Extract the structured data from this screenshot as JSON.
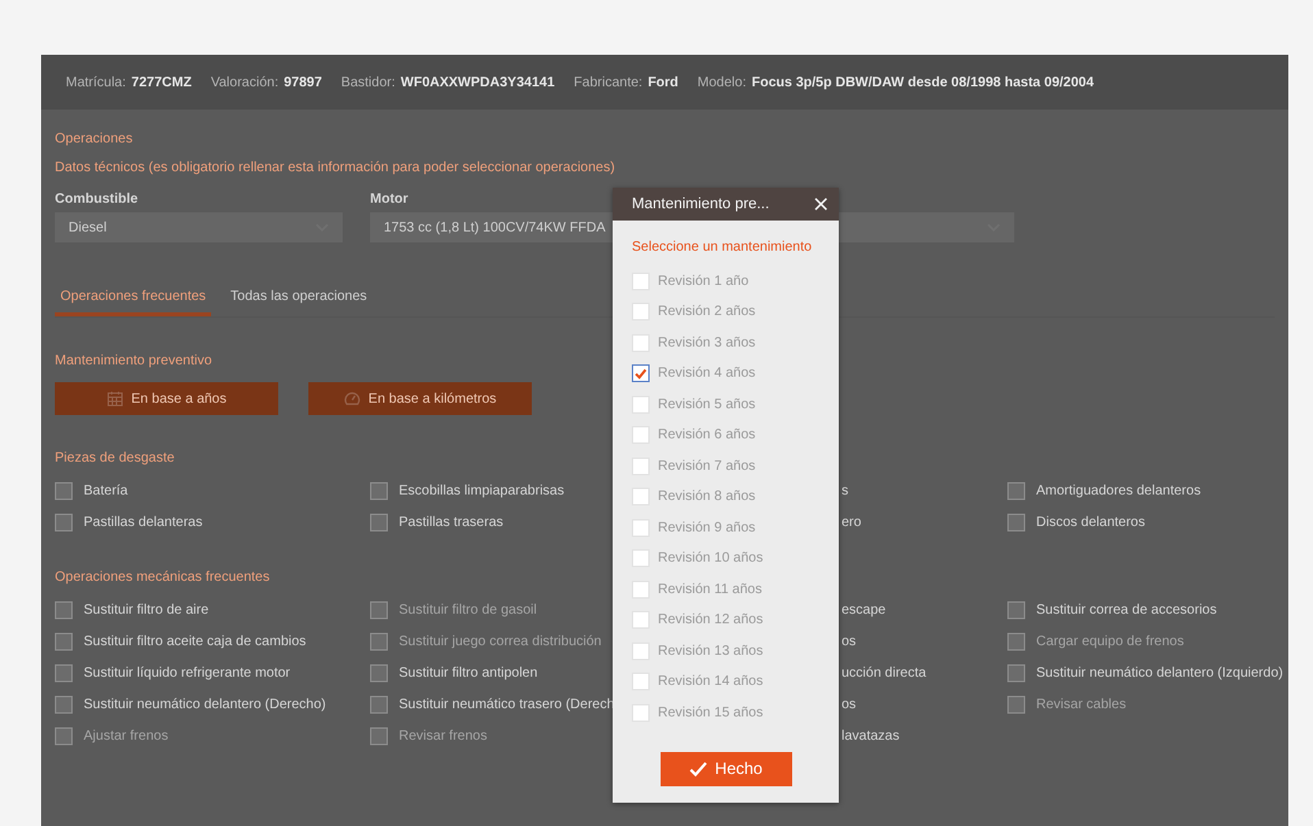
{
  "vehicle": [
    {
      "label": "Matrícula:",
      "value": "7277CMZ"
    },
    {
      "label": "Valoración:",
      "value": "97897"
    },
    {
      "label": "Bastidor:",
      "value": "WF0AXXWPDA3Y34141"
    },
    {
      "label": "Fabricante:",
      "value": "Ford"
    },
    {
      "label": "Modelo:",
      "value": "Focus 3p/5p DBW/DAW desde 08/1998 hasta 09/2004"
    }
  ],
  "operations_title": "Operaciones",
  "technical_note": "Datos técnicos (es obligatorio rellenar esta información para poder seleccionar operaciones)",
  "fuel": {
    "label": "Combustible",
    "value": "Diesel"
  },
  "engine": {
    "label": "Motor",
    "value": "1753 cc (1,8 Lt) 100CV/74KW FFDA"
  },
  "tabs": [
    {
      "label": "Operaciones frecuentes",
      "selected": true
    },
    {
      "label": "Todas las operaciones",
      "selected": false
    }
  ],
  "preventive": {
    "title": "Mantenimiento preventivo",
    "buttons": [
      {
        "label": "En base a años",
        "kind": "calendar"
      },
      {
        "label": "En base a kilómetros",
        "kind": "gauge"
      }
    ]
  },
  "groups": [
    {
      "title": "Piezas de desgaste",
      "rows": [
        [
          {
            "kind": "checkbox",
            "label": "Batería",
            "checked": false,
            "disabled": false
          },
          {
            "kind": "checkbox",
            "label": "Escobillas limpiaparabrisas",
            "checked": false,
            "disabled": false
          },
          {
            "kind": "cut",
            "label": "s"
          },
          {
            "kind": "checkbox",
            "label": "Amortiguadores delanteros",
            "checked": false,
            "disabled": false
          }
        ],
        [
          {
            "kind": "checkbox",
            "label": "Pastillas delanteras",
            "checked": false,
            "disabled": false
          },
          {
            "kind": "checkbox",
            "label": "Pastillas traseras",
            "checked": false,
            "disabled": false
          },
          {
            "kind": "cut",
            "label": "ero"
          },
          {
            "kind": "checkbox",
            "label": "Discos delanteros",
            "checked": false,
            "disabled": false
          }
        ]
      ]
    },
    {
      "title": "Operaciones mecánicas frecuentes",
      "rows": [
        [
          {
            "kind": "checkbox",
            "label": "Sustituir filtro de aire",
            "checked": false,
            "disabled": false
          },
          {
            "kind": "checkbox",
            "label": "Sustituir filtro de gasoil",
            "checked": false,
            "disabled": true
          },
          {
            "kind": "cut",
            "label": "escape"
          },
          {
            "kind": "checkbox",
            "label": "Sustituir correa de accesorios",
            "checked": false,
            "disabled": false
          }
        ],
        [
          {
            "kind": "checkbox",
            "label": "Sustituir filtro aceite caja de cambios",
            "checked": false,
            "disabled": false
          },
          {
            "kind": "checkbox",
            "label": "Sustituir juego correa distribución",
            "checked": false,
            "disabled": true
          },
          {
            "kind": "cut",
            "label": "os"
          },
          {
            "kind": "checkbox",
            "label": "Cargar equipo de frenos",
            "checked": false,
            "disabled": true
          }
        ],
        [
          {
            "kind": "checkbox",
            "label": "Sustituir líquido refrigerante motor",
            "checked": false,
            "disabled": false
          },
          {
            "kind": "checkbox",
            "label": "Sustituir filtro antipolen",
            "checked": false,
            "disabled": false
          },
          {
            "kind": "cut",
            "label": "ucción directa"
          },
          {
            "kind": "checkbox",
            "label": "Sustituir neumático delantero (Izquierdo)",
            "checked": false,
            "disabled": false
          }
        ],
        [
          {
            "kind": "checkbox",
            "label": "Sustituir neumático delantero (Derecho)",
            "checked": false,
            "disabled": false
          },
          {
            "kind": "checkbox",
            "label": "Sustituir neumático trasero (Derech",
            "checked": false,
            "disabled": false
          },
          {
            "kind": "cut",
            "label": "os"
          },
          {
            "kind": "checkbox",
            "label": "Revisar cables",
            "checked": false,
            "disabled": true
          }
        ],
        [
          {
            "kind": "checkbox",
            "label": "Ajustar frenos",
            "checked": false,
            "disabled": true
          },
          {
            "kind": "checkbox",
            "label": "Revisar frenos",
            "checked": false,
            "disabled": true
          },
          {
            "kind": "cut",
            "label": "lavatazas"
          }
        ]
      ]
    }
  ],
  "modal": {
    "title": "Mantenimiento pre...",
    "prompt": "Seleccione un mantenimiento",
    "done": "Hecho",
    "options": [
      {
        "label": "Revisión 1 año",
        "checked": false
      },
      {
        "label": "Revisión 2 años",
        "checked": false
      },
      {
        "label": "Revisión 3 años",
        "checked": false
      },
      {
        "label": "Revisión 4 años",
        "checked": true
      },
      {
        "label": "Revisión 5 años",
        "checked": false
      },
      {
        "label": "Revisión 6 años",
        "checked": false
      },
      {
        "label": "Revisión 7 años",
        "checked": false
      },
      {
        "label": "Revisión 8 años",
        "checked": false
      },
      {
        "label": "Revisión 9 años",
        "checked": false
      },
      {
        "label": "Revisión 10 años",
        "checked": false
      },
      {
        "label": "Revisión 11 años",
        "checked": false
      },
      {
        "label": "Revisión 12 años",
        "checked": false
      },
      {
        "label": "Revisión 13 años",
        "checked": false
      },
      {
        "label": "Revisión 14 años",
        "checked": false
      },
      {
        "label": "Revisión 15 años",
        "checked": false
      }
    ]
  }
}
